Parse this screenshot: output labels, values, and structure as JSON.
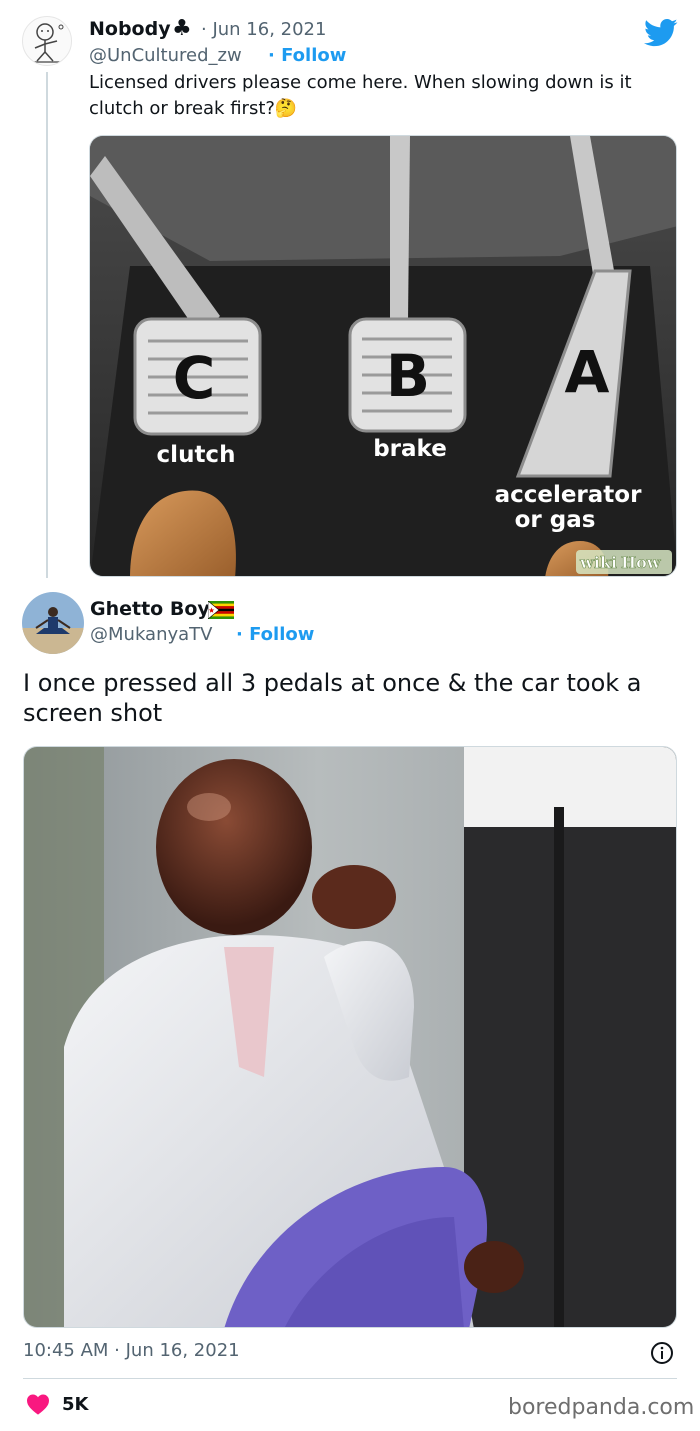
{
  "tweet": {
    "author": {
      "name": "Nobody",
      "name_suffix": "♣",
      "handle": "@UnCultured_zw",
      "follow_label": "Follow"
    },
    "date": "· Jun 16, 2021",
    "text": "Licensed drivers please come here. When slowing down is it clutch or break first?🤔",
    "image": {
      "pedals": [
        {
          "letter": "C",
          "label": "clutch"
        },
        {
          "letter": "B",
          "label": "brake"
        },
        {
          "letter": "A",
          "label_line1": "accelerator",
          "label_line2": "or gas"
        }
      ],
      "watermark_a": "wiki",
      "watermark_b": "How"
    }
  },
  "reply": {
    "author": {
      "name": "Ghetto Boy",
      "handle": "@MukanyaTV",
      "follow_label": "Follow"
    },
    "text": "I once pressed all 3 pedals at once & the car took a screen shot",
    "timestamp": "10:45 AM · Jun 16, 2021",
    "likes": "5K"
  },
  "footer": {
    "source": "boredpanda.com"
  },
  "colors": {
    "accent": "#1d9bf0",
    "heart": "#f91880",
    "muted": "#536471"
  },
  "icons": [
    "twitter-logo-icon",
    "info-icon",
    "heart-icon"
  ]
}
